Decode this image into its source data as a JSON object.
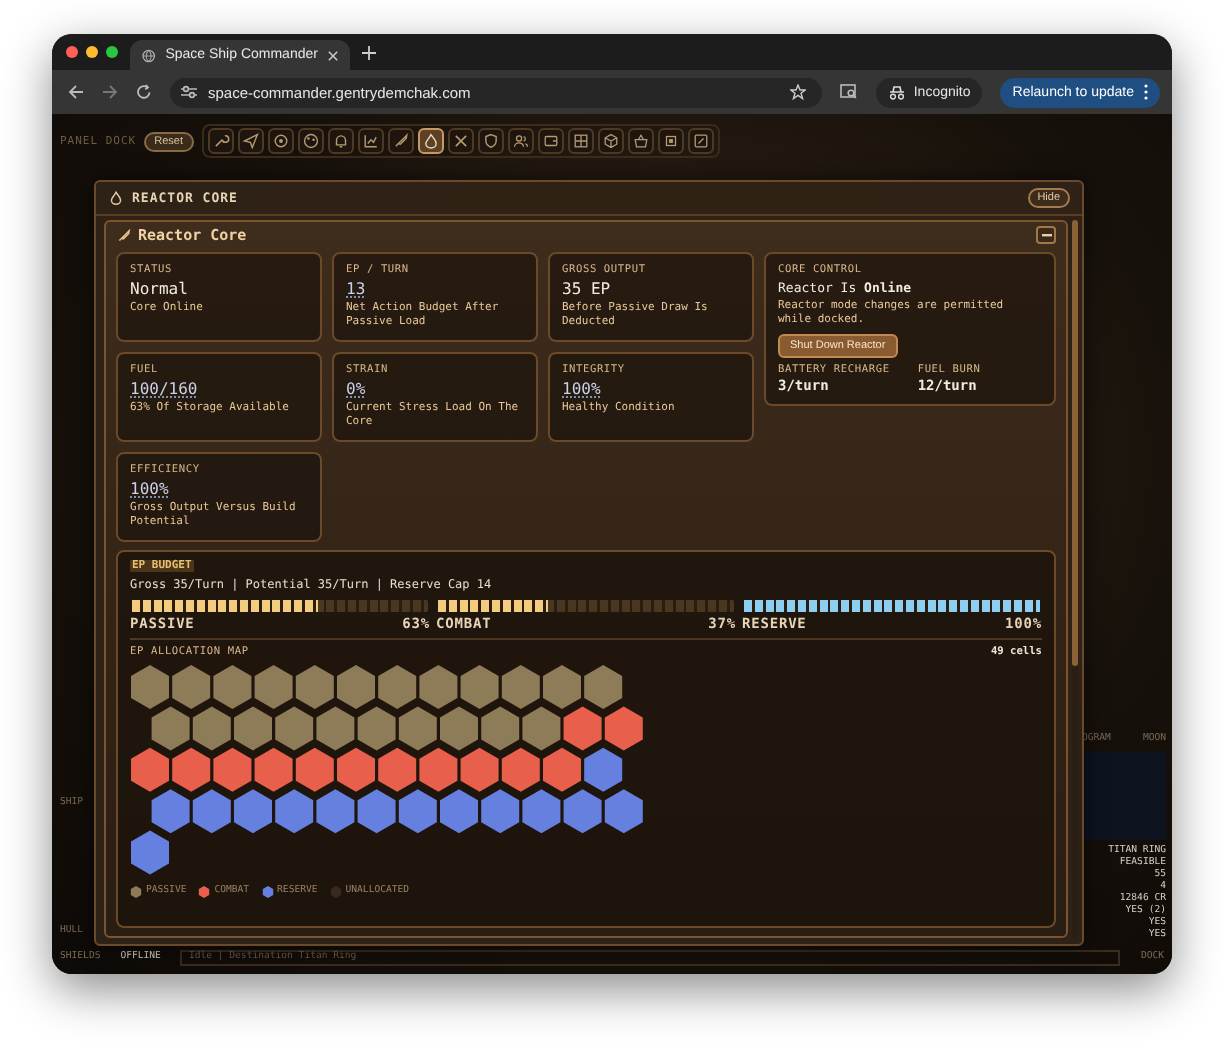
{
  "browser": {
    "tab_title": "Space Ship Commander",
    "url": "space-commander.gentrydemchak.com",
    "incognito_label": "Incognito",
    "relaunch_label": "Relaunch to update"
  },
  "dock": {
    "label": "PANEL DOCK",
    "reset_label": "Reset",
    "tools": [
      {
        "selected": false
      },
      {
        "selected": false
      },
      {
        "selected": false
      },
      {
        "selected": false
      },
      {
        "selected": false
      },
      {
        "selected": false
      },
      {
        "selected": false
      },
      {
        "selected": true
      },
      {
        "selected": false
      },
      {
        "selected": false
      },
      {
        "selected": false
      },
      {
        "selected": false
      },
      {
        "selected": false
      },
      {
        "selected": false
      },
      {
        "selected": false
      },
      {
        "selected": false
      },
      {
        "selected": false
      }
    ]
  },
  "panel": {
    "title": "REACTOR CORE",
    "hide_label": "Hide",
    "section_title": "Reactor Core",
    "stats": [
      {
        "label": "STATUS",
        "value": "Normal",
        "note": "Core Online",
        "linked": false
      },
      {
        "label": "EP / TURN",
        "value": "13",
        "note": "Net Action Budget After Passive Load",
        "linked": true
      },
      {
        "label": "GROSS OUTPUT",
        "value": "35 EP",
        "note": "Before Passive Draw Is Deducted",
        "linked": false
      },
      {
        "label": "FUEL",
        "value": "100/160",
        "note": "63% Of Storage Available",
        "linked": true
      },
      {
        "label": "STRAIN",
        "value": "0%",
        "note": "Current Stress Load On The Core",
        "linked": true
      },
      {
        "label": "INTEGRITY",
        "value": "100%",
        "note": "Healthy Condition",
        "linked": true
      },
      {
        "label": "EFFICIENCY",
        "value": "100%",
        "note": "Gross Output Versus Build Potential",
        "linked": true
      }
    ],
    "control": {
      "title": "CORE CONTROL",
      "state_text": "Reactor Is **Online**",
      "message": "Reactor mode changes are permitted while docked.",
      "button_label": "Shut Down Reactor",
      "readouts": [
        {
          "label": "BATTERY RECHARGE",
          "value": "3/turn"
        },
        {
          "label": "FUEL BURN",
          "value": "12/turn"
        }
      ]
    },
    "budget": {
      "title": "EP BUDGET",
      "summary": "Gross 35/Turn | Potential 35/Turn | Reserve Cap 14",
      "bars": [
        {
          "kind": "passive",
          "label": "PASSIVE",
          "percent": "63%",
          "level": 0.63
        },
        {
          "kind": "combat",
          "label": "COMBAT",
          "percent": "37%",
          "level": 0.37
        },
        {
          "kind": "reserve",
          "label": "RESERVE",
          "percent": "100%",
          "level": 1
        }
      ],
      "map_title": "EP ALLOCATION MAP",
      "map_count": "49 cells",
      "cells": [
        {
          "kind": "passive"
        },
        {
          "kind": "passive"
        },
        {
          "kind": "passive"
        },
        {
          "kind": "passive"
        },
        {
          "kind": "passive"
        },
        {
          "kind": "passive"
        },
        {
          "kind": "passive"
        },
        {
          "kind": "passive"
        },
        {
          "kind": "passive"
        },
        {
          "kind": "passive"
        },
        {
          "kind": "passive"
        },
        {
          "kind": "passive"
        },
        {
          "kind": "passive"
        },
        {
          "kind": "passive"
        },
        {
          "kind": "passive"
        },
        {
          "kind": "passive"
        },
        {
          "kind": "passive"
        },
        {
          "kind": "passive"
        },
        {
          "kind": "passive"
        },
        {
          "kind": "passive"
        },
        {
          "kind": "passive"
        },
        {
          "kind": "passive"
        },
        {
          "kind": "combat"
        },
        {
          "kind": "combat"
        },
        {
          "kind": "combat"
        },
        {
          "kind": "combat"
        },
        {
          "kind": "combat"
        },
        {
          "kind": "combat"
        },
        {
          "kind": "combat"
        },
        {
          "kind": "combat"
        },
        {
          "kind": "combat"
        },
        {
          "kind": "combat"
        },
        {
          "kind": "combat"
        },
        {
          "kind": "combat"
        },
        {
          "kind": "combat"
        },
        {
          "kind": "reserve"
        },
        {
          "kind": "reserve"
        },
        {
          "kind": "reserve"
        },
        {
          "kind": "reserve"
        },
        {
          "kind": "reserve"
        },
        {
          "kind": "reserve"
        },
        {
          "kind": "reserve"
        },
        {
          "kind": "reserve"
        },
        {
          "kind": "reserve"
        },
        {
          "kind": "reserve"
        },
        {
          "kind": "reserve"
        },
        {
          "kind": "reserve"
        },
        {
          "kind": "reserve"
        },
        {
          "kind": "reserve"
        }
      ],
      "legend": [
        {
          "kind": "passive",
          "label": "PASSIVE",
          "color": "#8e7b57"
        },
        {
          "kind": "combat",
          "label": "COMBAT",
          "color": "#e8604c"
        },
        {
          "kind": "reserve",
          "label": "RESERVE",
          "color": "#6680e0"
        },
        {
          "kind": "unallocated",
          "label": "UNALLOCATED",
          "color": "#3a2a1e"
        }
      ]
    }
  },
  "background": {
    "left_labels": [
      "SHIP"
    ],
    "bottom": {
      "hull_label": "HULL",
      "shields_label": "SHIELDS",
      "shields_value": "OFFLINE",
      "log": "Idle | Destination Titan Ring",
      "dock_label": "DOCK"
    },
    "right_headers": [
      "OGRAM",
      "MOON"
    ],
    "right_values": [
      "TITAN RING",
      "FEASIBLE",
      "55",
      "4",
      "12846 CR",
      "YES (2)",
      "YES",
      "YES"
    ]
  }
}
